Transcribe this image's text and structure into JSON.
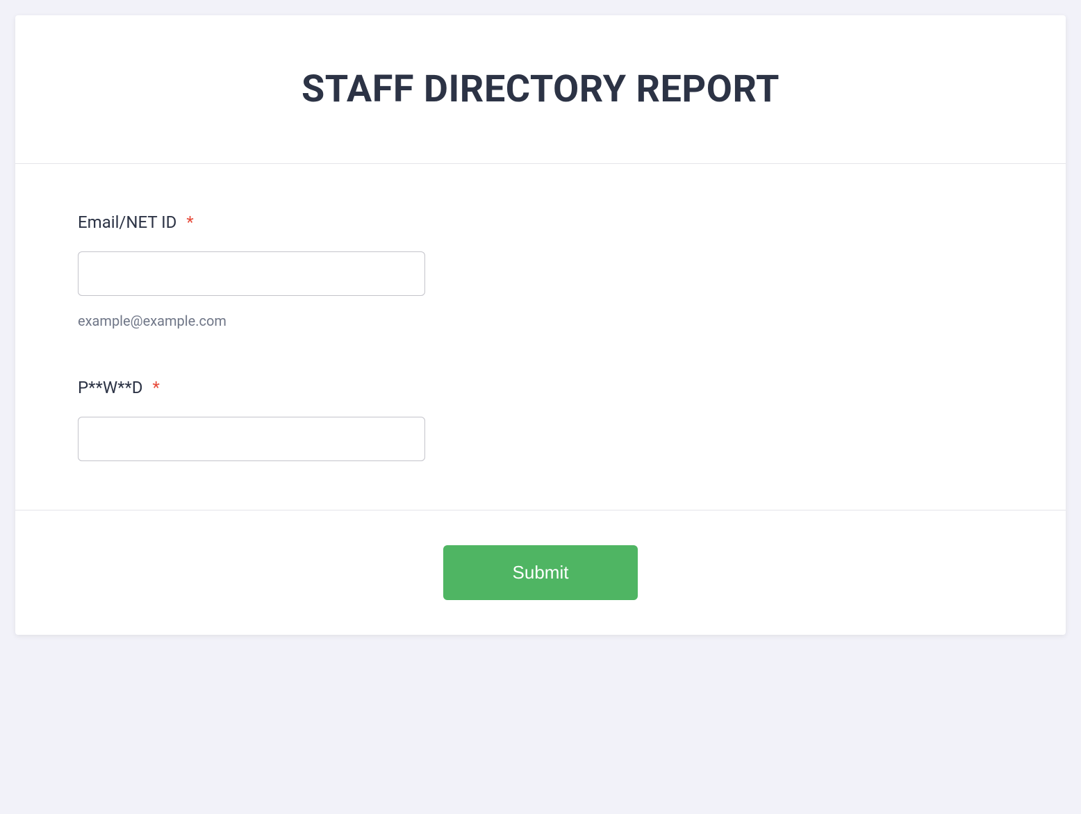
{
  "header": {
    "title": "STAFF DIRECTORY REPORT"
  },
  "fields": {
    "email": {
      "label": "Email/NET ID",
      "required_marker": "*",
      "value": "",
      "hint": "example@example.com"
    },
    "password": {
      "label": "P**W**D",
      "required_marker": "*",
      "value": ""
    }
  },
  "actions": {
    "submit_label": "Submit"
  }
}
